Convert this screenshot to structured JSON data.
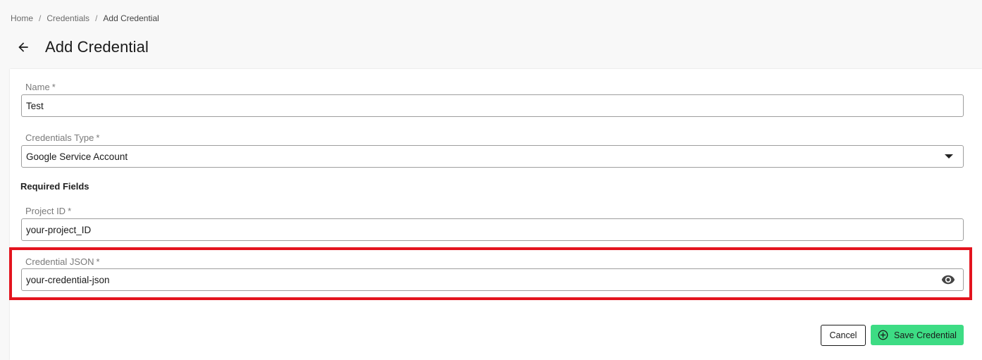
{
  "breadcrumb": {
    "items": [
      "Home",
      "Credentials",
      "Add Credential"
    ],
    "separator": "/"
  },
  "header": {
    "back_icon": "arrow-left-icon",
    "title": "Add Credential"
  },
  "form": {
    "name": {
      "label": "Name",
      "required_mark": "*",
      "value": "Test"
    },
    "credentials_type": {
      "label": "Credentials Type",
      "required_mark": "*",
      "value": "Google Service Account",
      "icon": "caret-down-icon"
    },
    "section_title": "Required Fields",
    "project_id": {
      "label": "Project ID",
      "required_mark": "*",
      "value": "your-project_ID"
    },
    "credential_json": {
      "label": "Credential JSON",
      "required_mark": "*",
      "value": "your-credential-json",
      "icon": "eye-icon"
    }
  },
  "actions": {
    "cancel_label": "Cancel",
    "save_label": "Save Credential",
    "save_icon": "plus-circle-icon"
  },
  "colors": {
    "highlight": "#e3141e",
    "save_button": "#3ddc84"
  }
}
